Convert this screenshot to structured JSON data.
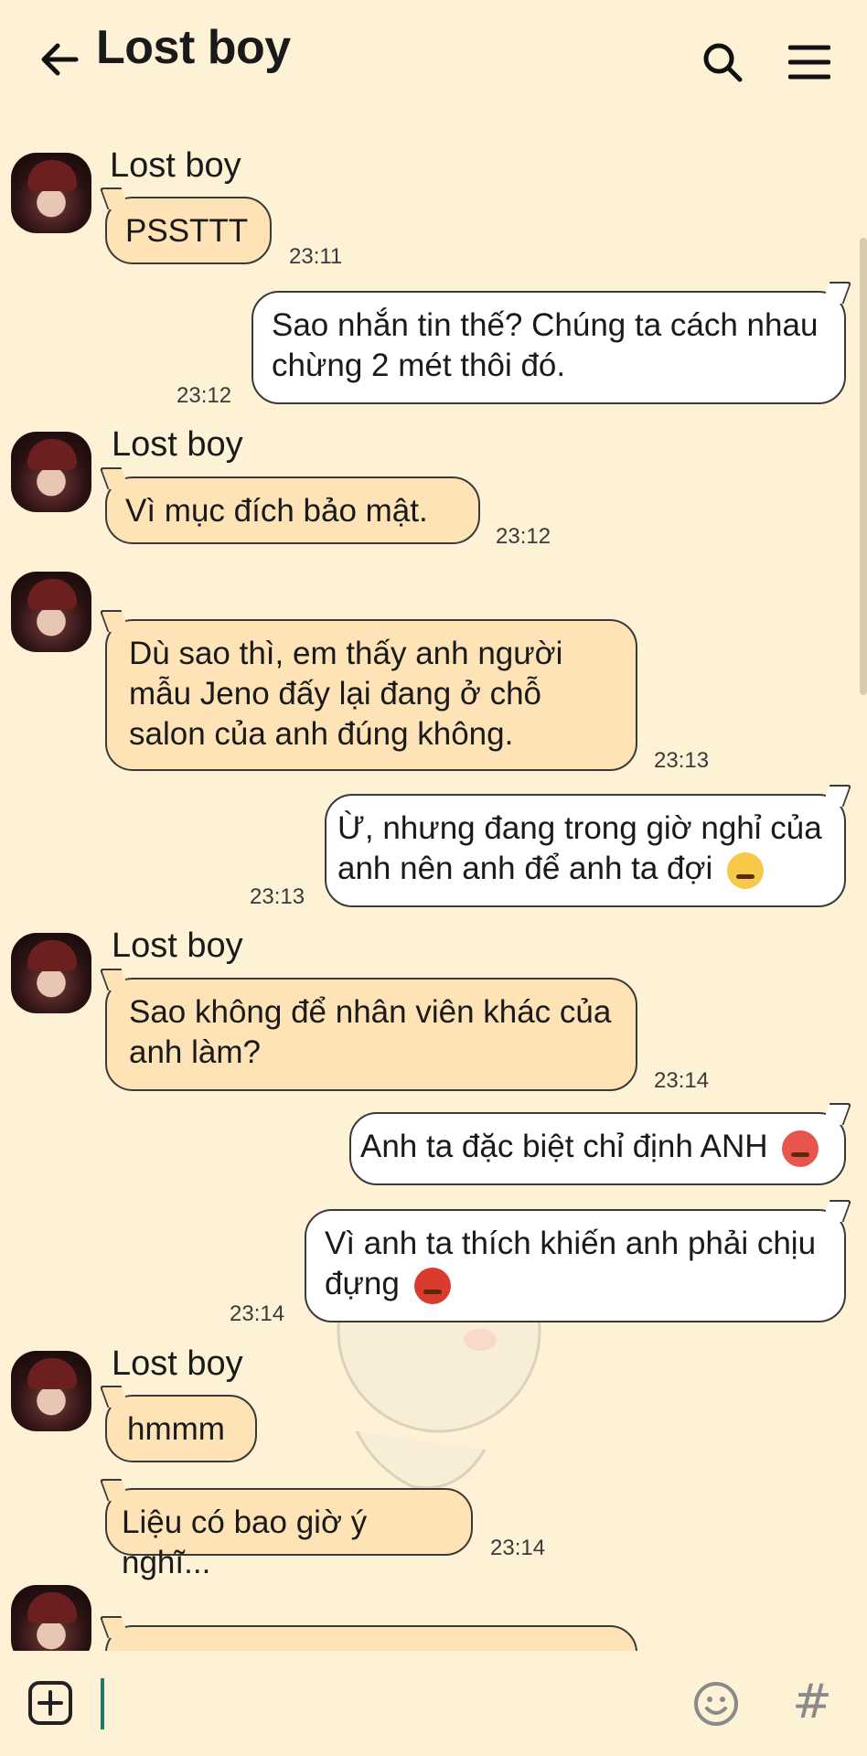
{
  "header": {
    "title": "Lost boy",
    "back_icon": "arrow-left-icon",
    "search_icon": "search-icon",
    "menu_icon": "hamburger-menu-icon"
  },
  "messages": [
    {
      "dir": "in",
      "sender": "Lost boy",
      "text": "PSSTTT",
      "time": "23:11"
    },
    {
      "dir": "out",
      "lines": [
        "Sao nhắn tin thế? Chúng ta cách nhau",
        "chừng 2 mét thôi đó."
      ],
      "time": "23:12"
    },
    {
      "dir": "in",
      "sender": "Lost boy",
      "text": "Vì mục đích bảo mật.",
      "time": "23:12"
    },
    {
      "dir": "in",
      "lines": [
        "Dù sao thì, em thấy anh người",
        "mẫu Jeno đấy lại đang ở chỗ",
        "salon của anh đúng không."
      ],
      "time": "23:13"
    },
    {
      "dir": "out",
      "lines": [
        "Ừ, nhưng đang trong giờ nghỉ của",
        "anh nên anh để anh ta đợi"
      ],
      "emoji": "sleepy-face-emoji",
      "time": "23:13"
    },
    {
      "dir": "in",
      "sender": "Lost boy",
      "lines": [
        "Sao không để nhân viên khác của",
        "anh làm?"
      ],
      "time": "23:14"
    },
    {
      "dir": "out",
      "text": "Anh ta đặc biệt chỉ định ANH",
      "emoji": "angry-face-emoji"
    },
    {
      "dir": "out",
      "lines": [
        "Vì anh ta thích khiến anh phải chịu",
        "đựng"
      ],
      "emoji": "cursing-face-emoji",
      "time": "23:14"
    },
    {
      "dir": "in",
      "sender": "Lost boy",
      "text": "hmmm"
    },
    {
      "dir": "in",
      "text": "Liệu có bao giờ ý nghĩ...",
      "time": "23:14"
    }
  ],
  "composer": {
    "add_icon": "plus-box-icon",
    "emoji_icon": "smiley-icon",
    "hash_label": "#",
    "input_value": ""
  },
  "colors": {
    "background": "#fdf2d6",
    "incoming_bubble": "#fde3b6",
    "outgoing_bubble": "#ffffff",
    "caret": "#1f7a6a"
  }
}
